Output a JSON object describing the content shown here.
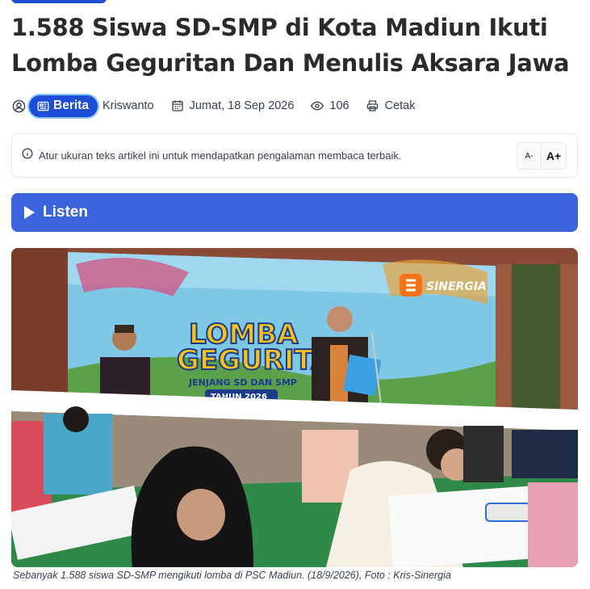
{
  "article": {
    "title": "1.588 Siswa SD-SMP di Kota Madiun Ikuti Lomba Geguritan Dan Menulis Aksara Jawa",
    "category": "Berita",
    "author": "Kriswanto",
    "date": "Jumat, 18 Sep 2026",
    "views": "106",
    "print_label": "Cetak"
  },
  "notice": {
    "text": "Atur ukuran teks artikel ini untuk mendapatkan pengalaman membaca terbaik.",
    "decrease_label": "A-",
    "increase_label": "A+"
  },
  "audio": {
    "listen_label": "Listen"
  },
  "image": {
    "watermark": "SINERGIA",
    "banner_title_1": "LOMBA",
    "banner_title_2": "GEGURITAN",
    "banner_sub": "JENJANG SD DAN SMP",
    "banner_year": "TAHUN 2026",
    "caption": "Sebanyak 1.588 siswa SD-SMP mengikuti lomba di PSC Madiun. (18/9/2026), Foto : Kris-Sinergia"
  },
  "colors": {
    "accent": "#1d4ed8",
    "listen_bg": "#3b63db",
    "watermark_orange": "#f97316"
  }
}
